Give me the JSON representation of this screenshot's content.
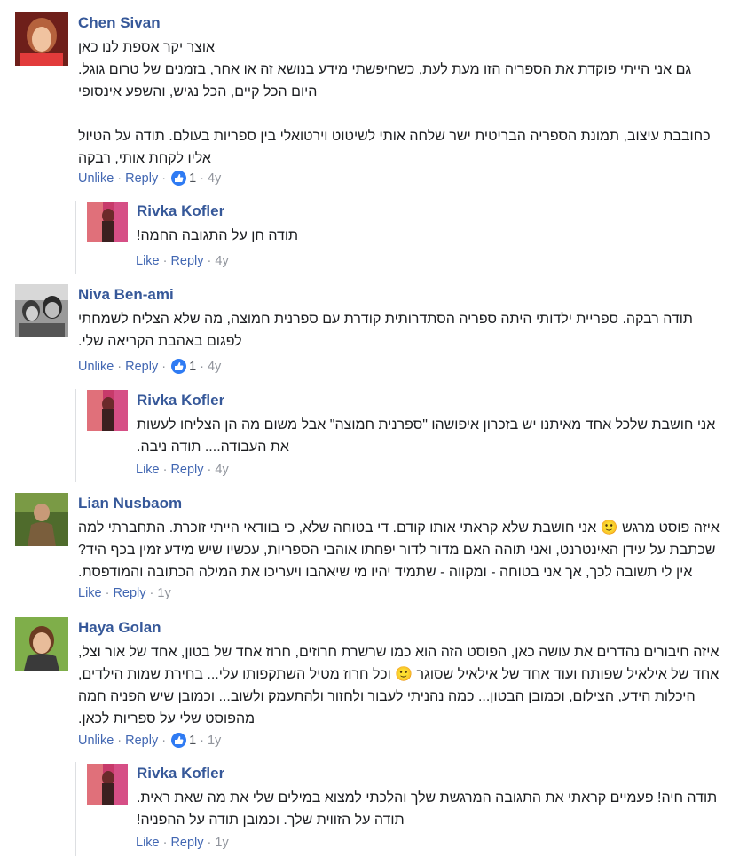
{
  "comments": [
    {
      "author": "Chen Sivan",
      "text": "אוצר יקר אספת לנו כאן\nגם אני הייתי פוקדת את הספריה הזו מעת לעת, כשחיפשתי מידע בנושא זה או אחר, בזמנים של טרום גוגל.\nהיום הכל קיים, הכל נגיש, והשפע אינסופי\n\nכחובבת עיצוב, תמונת הספריה הבריטית ישר שלחה אותי לשיטוט וירטואלי בין ספריות בעולם. תודה על הטיול\nאליו לקחת אותי, רבקה",
      "action1": "Unlike",
      "action2": "Reply",
      "likes": "1",
      "time": "4y",
      "reply": {
        "author": "Rivka Kofler",
        "text": "תודה חן על התגובה החמה!",
        "action1": "Like",
        "action2": "Reply",
        "time": "4y"
      }
    },
    {
      "author": "Niva Ben-ami",
      "text": "תודה רבקה. ספריית ילדותי היתה ספריה הסתדרותית קודרת עם ספרנית חמוצה, מה שלא הצליח לשמחתי\nלפגום באהבת הקריאה שלי.",
      "action1": "Unlike",
      "action2": "Reply",
      "likes": "1",
      "time": "4y",
      "reply": {
        "author": "Rivka Kofler",
        "text": "אני חושבת שלכל אחד מאיתנו יש בזכרון איפושהו \"ספרנית חמוצה\" אבל משום מה הן הצליחו לעשות\nאת העבודה.... תודה ניבה.",
        "action1": "Like",
        "action2": "Reply",
        "time": "4y"
      }
    },
    {
      "author": "Lian Nusbaom",
      "text": "איזה פוסט מרגש 🙂 אני חושבת שלא קראתי אותו קודם. די בטוחה שלא, כי בוודאי הייתי זוכרת. התחברתי למה\nשכתבת על עידן האינטרנט, ואני תוהה האם מדור לדור יפחתו אוהבי הספריות, עכשיו שיש מידע זמין בכף היד?\nאין לי תשובה לכך, אך אני בטוחה - ומקווה - שתמיד יהיו מי שיאהבו ויעריכו את המילה הכתובה והמודפסת.",
      "action1": "Like",
      "action2": "Reply",
      "time": "1y"
    },
    {
      "author": "Haya Golan",
      "text": "איזה חיבורים נהדרים את עושה כאן, הפוסט הזה הוא כמו שרשרת חרוזים, חרוז אחד של בטון, אחד של אור וצל,\nאחד של אילאיל שפותח ועוד אחד של אילאיל שסוגר 🙂 וכל חרוז מטיל השתקפותו עלי... בחירת שמות הילדים,\nהיכלות הידע, הצילום, וכמובן הבטון... כמה נהניתי לעבור ולחזור ולהתעמק ולשוב... וכמובן שיש הפניה חמה\nמהפוסט שלי על ספריות לכאן.",
      "action1": "Unlike",
      "action2": "Reply",
      "likes": "1",
      "time": "1y",
      "reply": {
        "author": "Rivka Kofler",
        "text": "תודה חיה! פעמיים קראתי את התגובה המרגשת שלך והלכתי למצוא במילים שלי את מה שאת ראית.\nתודה על הזווית שלך. וכמובן תודה על ההפניה!",
        "action1": "Like",
        "action2": "Reply",
        "time": "1y"
      }
    }
  ],
  "dot": "·",
  "colors": {
    "author": "#365899",
    "link": "#4267b2",
    "meta": "#90949c",
    "like": "#2f7bf3"
  }
}
